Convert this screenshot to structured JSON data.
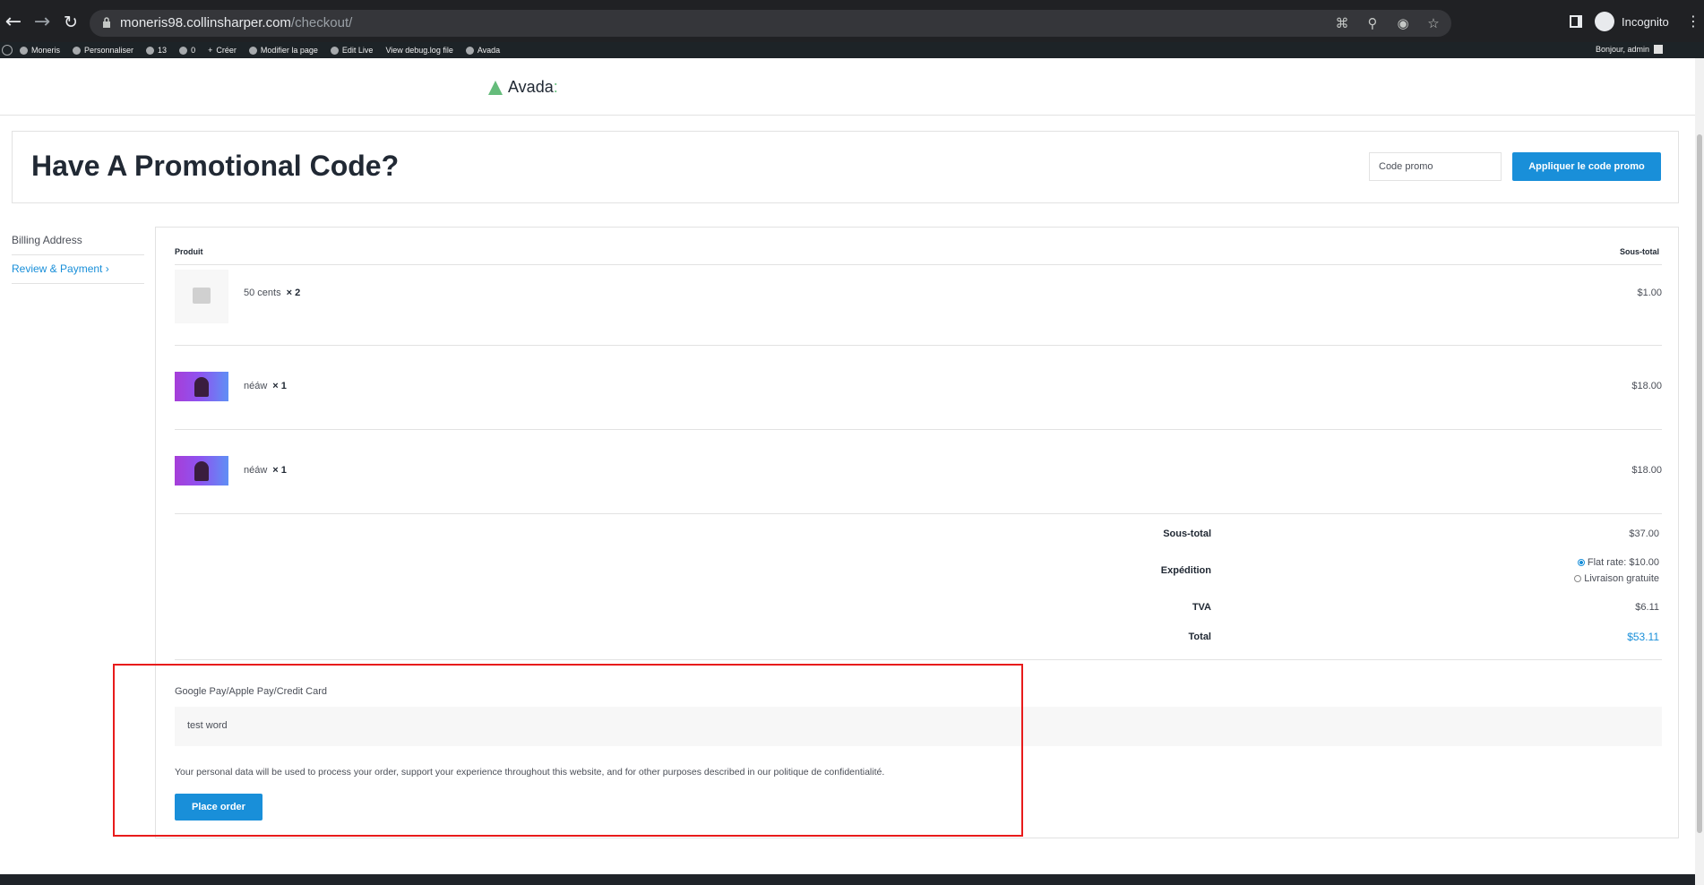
{
  "browser": {
    "url_host": "moneris98.collinsharper.com",
    "url_path": "/checkout/",
    "profile_label": "Incognito"
  },
  "adminbar": {
    "items": [
      "Moneris",
      "Personnaliser",
      "13",
      "0",
      "Créer",
      "Modifier la page",
      "Edit Live",
      "View debug.log file",
      "Avada"
    ],
    "greeting": "Bonjour, admin"
  },
  "header": {
    "logo_text": "Avada",
    "logo_colon": ":"
  },
  "promo": {
    "title": "Have A Promotional Code?",
    "input_placeholder": "Code promo",
    "button_label": "Appliquer le code promo"
  },
  "steps": {
    "billing": "Billing Address",
    "review": "Review & Payment ›"
  },
  "order": {
    "col_product": "Produit",
    "col_subtotal": "Sous-total",
    "items": [
      {
        "name": "50 cents",
        "qty": "× 2",
        "price": "$1.00"
      },
      {
        "name": "néáw",
        "qty": "× 1",
        "price": "$18.00"
      },
      {
        "name": "néáw",
        "qty": "× 1",
        "price": "$18.00"
      }
    ],
    "subtotal_label": "Sous-total",
    "subtotal_value": "$37.00",
    "shipping_label": "Expédition",
    "shipping_option_1": "Flat rate: $10.00",
    "shipping_option_2": "Livraison gratuite",
    "tax_label": "TVA",
    "tax_value": "$6.11",
    "total_label": "Total",
    "total_value": "$53.11"
  },
  "payment": {
    "method_label": "Google Pay/Apple Pay/Credit Card",
    "description": "test word",
    "privacy_text": "Your personal data will be used to process your order, support your experience throughout this website, and for other purposes described in our politique de confidentialité.",
    "place_order_label": "Place order"
  },
  "colors": {
    "accent": "#198fd9",
    "brand_green": "#65bc7b",
    "highlight": "#e81b1b"
  }
}
